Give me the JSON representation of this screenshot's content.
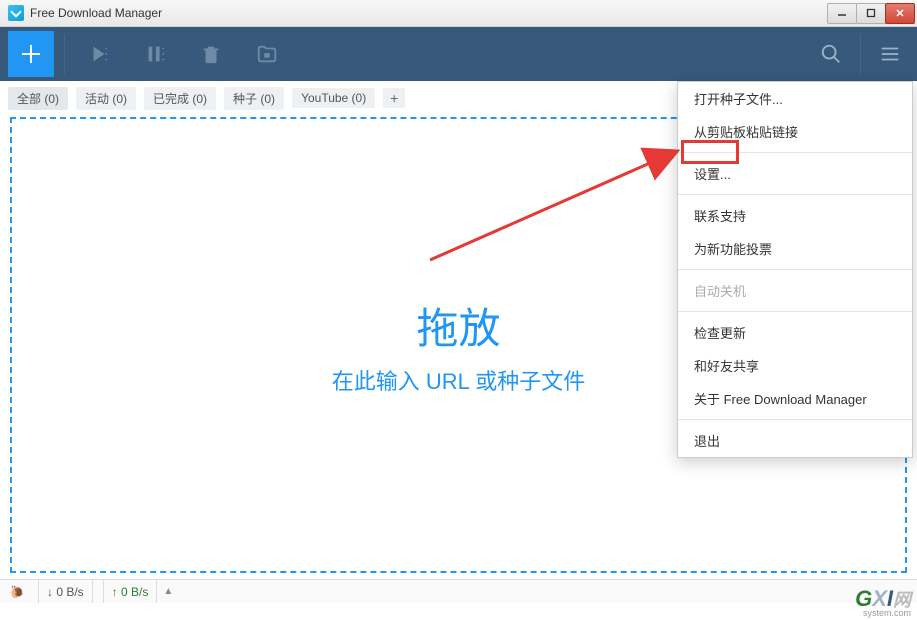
{
  "titlebar": {
    "title": "Free Download Manager"
  },
  "filters": {
    "all": "全部 (0)",
    "active": "活动 (0)",
    "done": "已完成 (0)",
    "seed": "种子 (0)",
    "youtube": "YouTube (0)"
  },
  "drop": {
    "big": "拖放",
    "sub": "在此输入 URL 或种子文件"
  },
  "status": {
    "down": "↓  0 B/s",
    "up": "↑  0 B/s"
  },
  "menu": {
    "openSeed": "打开种子文件...",
    "pasteClip": "从剪贴板粘贴链接",
    "settings": "设置...",
    "contact": "联系支持",
    "vote": "为新功能投票",
    "autoOff": "自动关机",
    "checkUpdate": "检查更新",
    "share": "和好友共享",
    "about": "关于 Free Download Manager",
    "exit": "退出"
  },
  "watermark": {
    "g": "G",
    "x": "X",
    "i": "I",
    "cn": "网",
    "sub": "system.com"
  }
}
